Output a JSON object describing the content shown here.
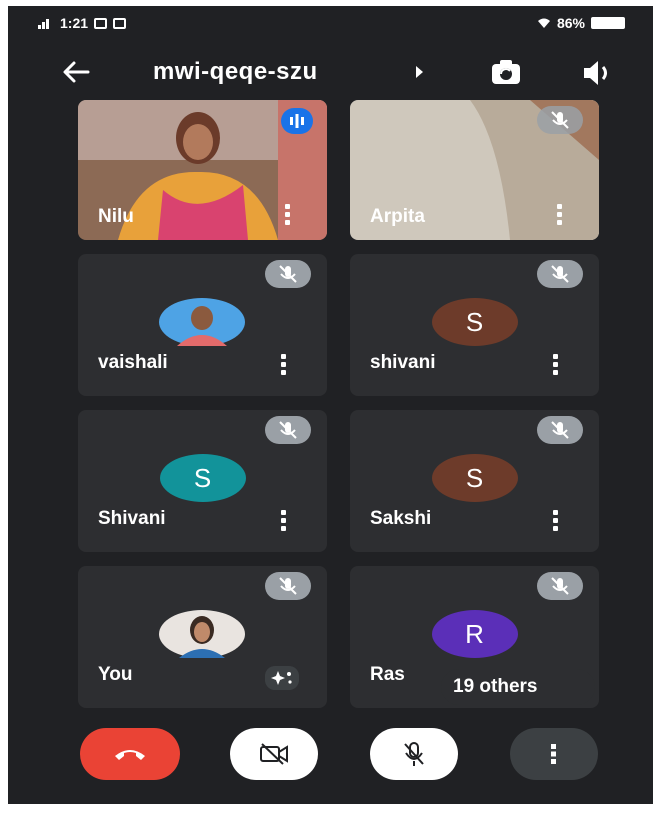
{
  "status_bar": {
    "time": "1:21",
    "battery": "86%"
  },
  "header": {
    "meeting_code": "mwi-qeqe-szu"
  },
  "tiles": [
    {
      "name": "Nilu",
      "type": "video"
    },
    {
      "name": "Arpita",
      "type": "video"
    },
    {
      "name": "vaishali",
      "type": "audio",
      "avatar": "photo"
    },
    {
      "name": "shivani",
      "type": "audio",
      "avatar": "S"
    },
    {
      "name": "Shivani",
      "type": "audio",
      "avatar": "S"
    },
    {
      "name": "Sakshi",
      "type": "audio",
      "avatar": "S"
    },
    {
      "name": "You",
      "type": "audio",
      "avatar": "photo"
    },
    {
      "name": "Ras",
      "type": "audio",
      "avatar": "R"
    }
  ],
  "others_overlay": "19 others",
  "colors": {
    "end_call": "#ea4335",
    "avatar_teal": "#12939a",
    "avatar_brown": "#6d3b2a",
    "avatar_purple": "#5b2fb8",
    "speaking_indicator": "#1a73e8"
  },
  "icons": [
    "back-arrow-icon",
    "caret-right-icon",
    "switch-camera-icon",
    "speaker-icon",
    "mic-off-icon",
    "more-vert-icon",
    "end-call-icon",
    "camera-off-icon",
    "effects-icon",
    "speaking-icon"
  ]
}
